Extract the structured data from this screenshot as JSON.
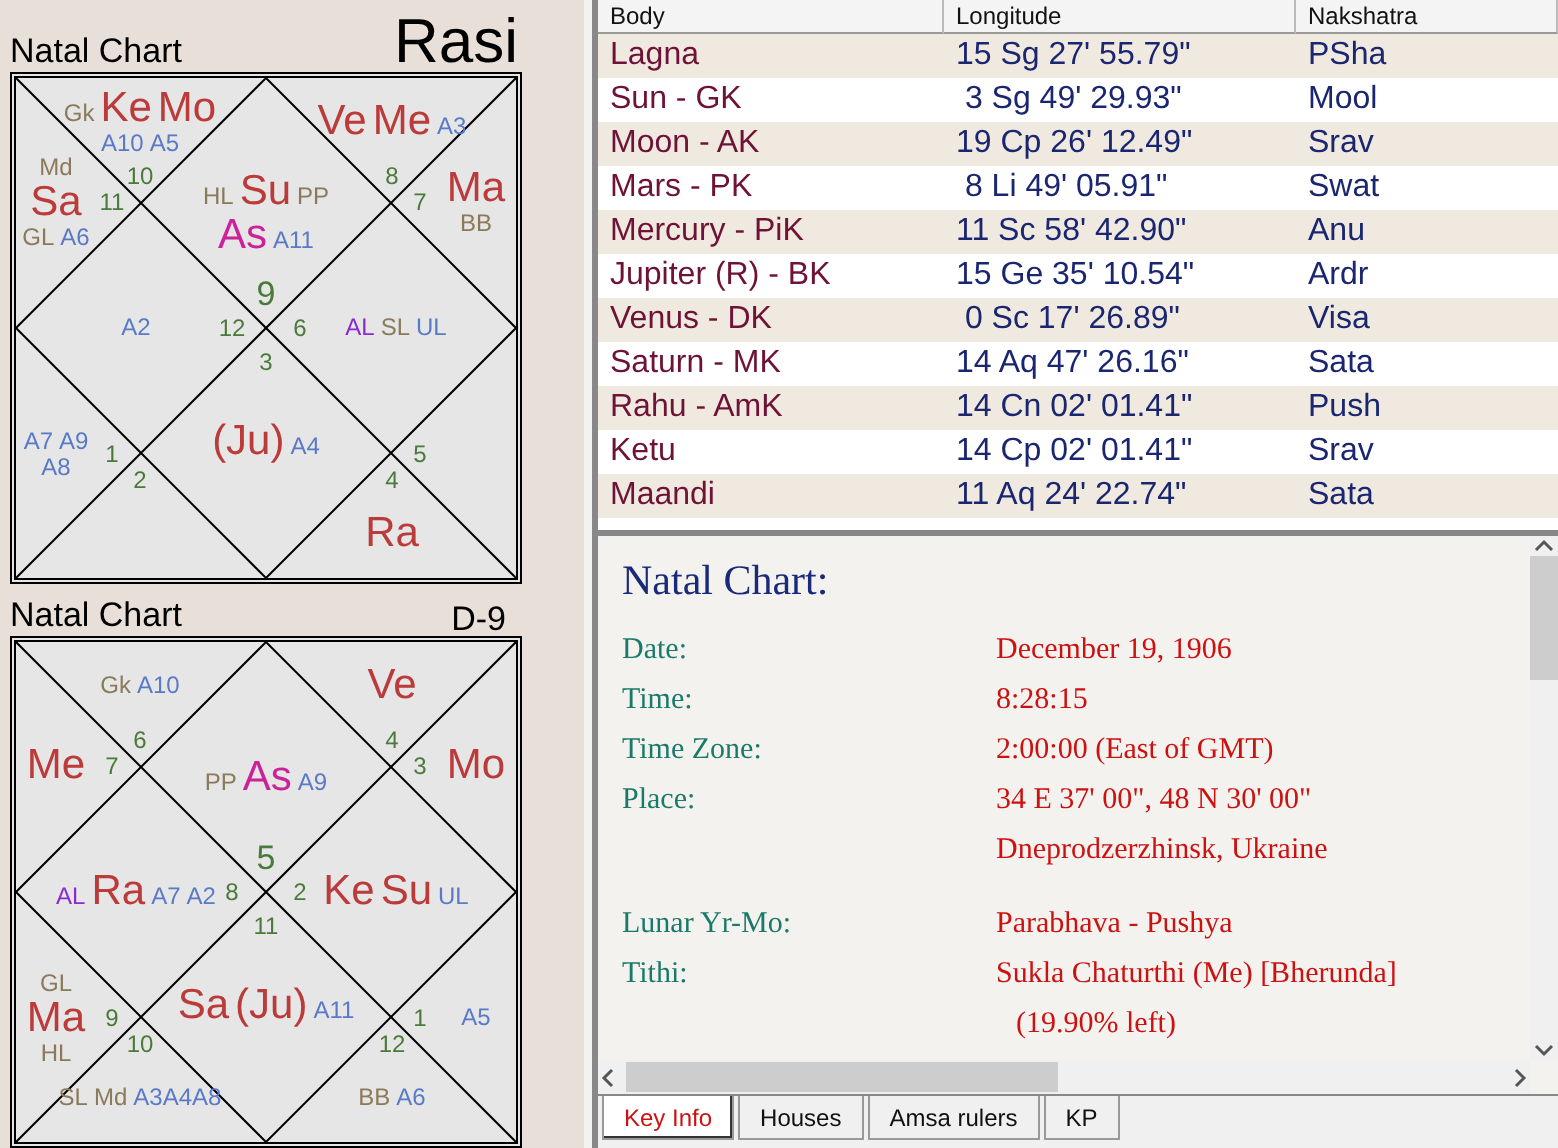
{
  "charts": [
    {
      "title": "Natal Chart",
      "varga": "Rasi",
      "varga_emphasis": true,
      "houses": [
        {
          "sign": "10",
          "items": [
            {
              "text": "Gk",
              "kind": "special"
            },
            {
              "text": "Ke",
              "kind": "planet"
            },
            {
              "text": "Mo",
              "kind": "planet"
            },
            {
              "text": "A10",
              "kind": "arudha"
            },
            {
              "text": "A5",
              "kind": "arudha"
            }
          ]
        },
        {
          "sign": "8",
          "items": [
            {
              "text": "Ve",
              "kind": "planet"
            },
            {
              "text": "Me",
              "kind": "planet"
            },
            {
              "text": "A3",
              "kind": "arudha"
            }
          ]
        },
        {
          "sign": "11",
          "items": [
            {
              "text": "Md",
              "kind": "special"
            },
            {
              "text": "Sa",
              "kind": "planet"
            },
            {
              "text": "GL",
              "kind": "special"
            },
            {
              "text": "A6",
              "kind": "arudha"
            }
          ]
        },
        {
          "sign": "9",
          "items": [
            {
              "text": "HL",
              "kind": "special"
            },
            {
              "text": "Su",
              "kind": "planet"
            },
            {
              "text": "PP",
              "kind": "special"
            },
            {
              "text": "As",
              "kind": "lagna"
            },
            {
              "text": "A11",
              "kind": "arudha"
            }
          ]
        },
        {
          "sign": "7",
          "items": [
            {
              "text": "Ma",
              "kind": "planet"
            },
            {
              "text": "BB",
              "kind": "special"
            }
          ]
        },
        {
          "sign": "12",
          "items": [
            {
              "text": "A2",
              "kind": "arudha"
            }
          ]
        },
        {
          "sign": "6",
          "items": [
            {
              "text": "AL",
              "kind": "arudha_lagna"
            },
            {
              "text": "SL",
              "kind": "special"
            },
            {
              "text": "UL",
              "kind": "arudha"
            }
          ]
        },
        {
          "sign": "3",
          "items": [
            {
              "text": "(Ju)",
              "kind": "planet"
            },
            {
              "text": "A4",
              "kind": "arudha"
            }
          ]
        },
        {
          "sign": "1",
          "items": [
            {
              "text": "A7",
              "kind": "arudha"
            },
            {
              "text": "A9",
              "kind": "arudha"
            },
            {
              "text": "A8",
              "kind": "arudha"
            }
          ]
        },
        {
          "sign": "5"
        },
        {
          "sign": "2"
        },
        {
          "sign": "4",
          "items": [
            {
              "text": "Ra",
              "kind": "planet"
            }
          ]
        }
      ]
    },
    {
      "title": "Natal Chart",
      "varga": "D-9",
      "varga_emphasis": false,
      "houses": [
        {
          "sign": "6",
          "items": [
            {
              "text": "Gk",
              "kind": "special"
            },
            {
              "text": "A10",
              "kind": "arudha"
            }
          ]
        },
        {
          "sign": "4",
          "items": [
            {
              "text": "Ve",
              "kind": "planet"
            }
          ]
        },
        {
          "sign": "7",
          "items": [
            {
              "text": "Me",
              "kind": "planet"
            }
          ]
        },
        {
          "sign": "5",
          "items": [
            {
              "text": "PP",
              "kind": "special"
            },
            {
              "text": "As",
              "kind": "lagna"
            },
            {
              "text": "A9",
              "kind": "arudha"
            }
          ]
        },
        {
          "sign": "3",
          "items": [
            {
              "text": "Mo",
              "kind": "planet"
            }
          ]
        },
        {
          "sign": "8",
          "items": [
            {
              "text": "AL",
              "kind": "arudha_lagna"
            },
            {
              "text": "Ra",
              "kind": "planet"
            },
            {
              "text": "A7",
              "kind": "arudha"
            },
            {
              "text": "A2",
              "kind": "arudha"
            }
          ]
        },
        {
          "sign": "2",
          "items": [
            {
              "text": "Ke",
              "kind": "planet"
            },
            {
              "text": "Su",
              "kind": "planet"
            },
            {
              "text": "UL",
              "kind": "arudha"
            }
          ]
        },
        {
          "sign": "11",
          "items": [
            {
              "text": "Sa",
              "kind": "planet"
            },
            {
              "text": "(Ju)",
              "kind": "planet"
            },
            {
              "text": "A11",
              "kind": "arudha"
            }
          ]
        },
        {
          "sign": "9",
          "items": [
            {
              "text": "GL",
              "kind": "special"
            },
            {
              "text": "Ma",
              "kind": "planet"
            },
            {
              "text": "HL",
              "kind": "special"
            }
          ]
        },
        {
          "sign": "1",
          "items": [
            {
              "text": "A5",
              "kind": "arudha"
            }
          ]
        },
        {
          "sign": "10",
          "items": [
            {
              "text": "SL",
              "kind": "special"
            },
            {
              "text": "Md",
              "kind": "special"
            },
            {
              "text": "A3A4A8",
              "kind": "arudha"
            }
          ]
        },
        {
          "sign": "12",
          "items": [
            {
              "text": "BB",
              "kind": "special"
            },
            {
              "text": "A6",
              "kind": "arudha"
            }
          ]
        }
      ]
    }
  ],
  "table": {
    "columns": [
      "Body",
      "Longitude",
      "Nakshatra"
    ],
    "rows": [
      [
        "Lagna",
        "15 Sg 27' 55.79\"",
        "PSha"
      ],
      [
        "Sun - GK",
        " 3 Sg 49' 29.93\"",
        "Mool"
      ],
      [
        "Moon - AK",
        "19 Cp 26' 12.49\"",
        "Srav"
      ],
      [
        "Mars - PK",
        " 8 Li 49' 05.91\"",
        "Swat"
      ],
      [
        "Mercury - PiK",
        "11 Sc 58' 42.90\"",
        "Anu"
      ],
      [
        "Jupiter (R) - BK",
        "15 Ge 35' 10.54\"",
        "Ardr"
      ],
      [
        "Venus - DK",
        " 0 Sc 17' 26.89\"",
        "Visa"
      ],
      [
        "Saturn - MK",
        "14 Aq 47' 26.16\"",
        "Sata"
      ],
      [
        "Rahu - AmK",
        "14 Cn 02' 01.41\"",
        "Push"
      ],
      [
        "Ketu",
        "14 Cp 02' 01.41\"",
        "Srav"
      ],
      [
        "Maandi",
        "11 Aq 24' 22.74\"",
        "Sata"
      ]
    ]
  },
  "info": {
    "heading": "Natal Chart:",
    "rows": [
      {
        "label": "Date:",
        "lines": [
          "December 19, 1906"
        ]
      },
      {
        "label": "Time:",
        "lines": [
          "8:28:15"
        ]
      },
      {
        "label": "Time Zone:",
        "lines": [
          "2:00:00 (East of GMT)"
        ]
      },
      {
        "label": "Place:",
        "lines": [
          "34 E 37' 00\", 48 N 30' 00\"",
          "Dneprodzerzhinsk, Ukraine"
        ]
      },
      {
        "label": "Lunar Yr-Mo:",
        "lines": [
          "Parabhava - Pushya"
        ],
        "gap_before": true
      },
      {
        "label": "Tithi:",
        "lines": [
          "Sukla Chaturthi (Me) [Bherunda]",
          "(19.90% left)"
        ]
      }
    ]
  },
  "tabs": [
    {
      "label": "Key Info",
      "selected": true
    },
    {
      "label": "Houses",
      "selected": false
    },
    {
      "label": "Amsa rulers",
      "selected": false
    },
    {
      "label": "KP",
      "selected": false
    }
  ]
}
